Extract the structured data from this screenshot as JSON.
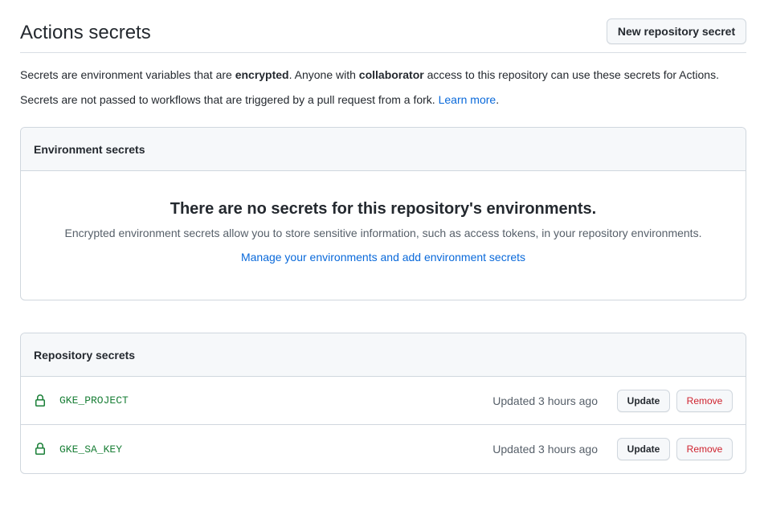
{
  "header": {
    "title": "Actions secrets",
    "new_button_label": "New repository secret"
  },
  "description": {
    "line1_part1": "Secrets are environment variables that are ",
    "line1_bold1": "encrypted",
    "line1_part2": ". Anyone with ",
    "line1_bold2": "collaborator",
    "line1_part3": " access to this repository can use these secrets for Actions.",
    "line2_text": "Secrets are not passed to workflows that are triggered by a pull request from a fork. ",
    "line2_link": "Learn more",
    "line2_end": "."
  },
  "environment_secrets": {
    "title": "Environment secrets",
    "blank_title": "There are no secrets for this repository's environments.",
    "blank_desc": "Encrypted environment secrets allow you to store sensitive information, such as access tokens, in your repository environments.",
    "blank_link": "Manage your environments and add environment secrets"
  },
  "repository_secrets": {
    "title": "Repository secrets",
    "items": [
      {
        "name": "GKE_PROJECT",
        "updated": "Updated 3 hours ago",
        "update_label": "Update",
        "remove_label": "Remove"
      },
      {
        "name": "GKE_SA_KEY",
        "updated": "Updated 3 hours ago",
        "update_label": "Update",
        "remove_label": "Remove"
      }
    ]
  },
  "colors": {
    "link": "#0969da",
    "secret_name": "#1a7f37",
    "remove": "#cf222e",
    "lock_icon": "#1a7f37"
  },
  "icons": {
    "secret_row": "lock-icon"
  }
}
